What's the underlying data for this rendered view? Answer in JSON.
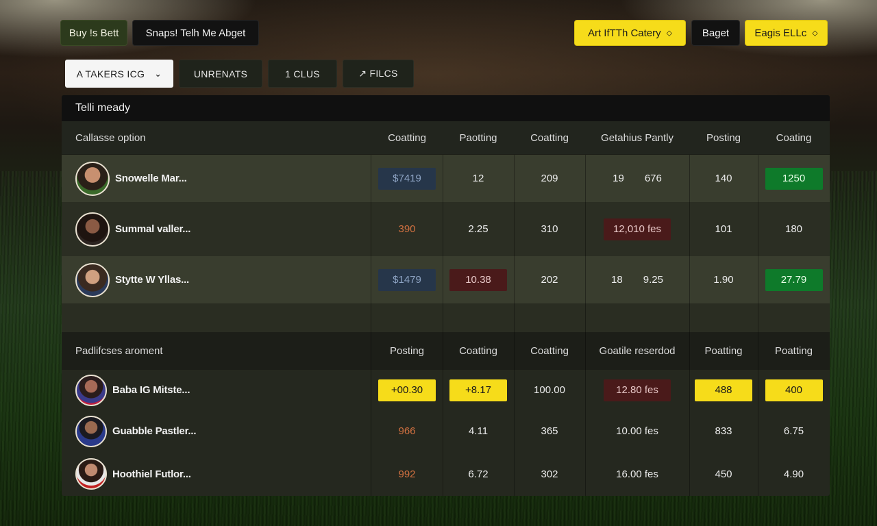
{
  "top_left_buttons": [
    "Buy !s Bett",
    "Snaps! Telh Me Abget"
  ],
  "top_right_buttons": [
    {
      "label": "Art IfTTh Catery",
      "chevron": "⬦"
    },
    {
      "label": "Baget"
    },
    {
      "label": "Eagis ELLc",
      "chevron": "⬦"
    }
  ],
  "filters": [
    {
      "label": "A TAKERS ICG",
      "chevron": "⌄"
    },
    {
      "label": "UNRENATS"
    },
    {
      "label": "1 CLUS"
    },
    {
      "label": "↗ FILCS"
    }
  ],
  "panel": {
    "title": "Telli meady"
  },
  "section1": {
    "header": [
      "Callasse option",
      "Coatting",
      "Paotting",
      "Coatting",
      "Getahius Pantly",
      "Posting",
      "Coating"
    ],
    "rows": [
      {
        "name": "Snowelle Mar...",
        "cells": [
          "$7419",
          "12",
          "209",
          "19",
          "676",
          "140",
          "1250"
        ]
      },
      {
        "name": "Summal valler...",
        "cells": [
          "390",
          "2.25",
          "310",
          "12,010 fes",
          "101",
          "180"
        ]
      },
      {
        "name": "Stytte W Yllas...",
        "cells": [
          "$1479",
          "10.38",
          "202",
          "18",
          "9.25",
          "1.90",
          "27.79"
        ]
      }
    ]
  },
  "section2": {
    "header": [
      "Padlifcses aroment",
      "Posting",
      "Coatting",
      "Coatting",
      "Goatile reserdod",
      "Poatting",
      "Poatting"
    ],
    "rows": [
      {
        "name": "Baba IG Mitste...",
        "cells": [
          "+00.30",
          "+8.17",
          "100.00",
          "12.80 fes",
          "488",
          "400"
        ]
      },
      {
        "name": "Guabble Pastler...",
        "cells": [
          "966",
          "4.11",
          "365",
          "10.00 fes",
          "833",
          "6.75"
        ]
      },
      {
        "name": "Hoothiel Futlor...",
        "cells": [
          "992",
          "6.72",
          "302",
          "16.00 fes",
          "450",
          "4.90"
        ]
      }
    ]
  },
  "colors": {
    "accent_yellow": "#f6dc1a",
    "positive_green": "#0e7a2a",
    "negative_red": "#4a1a1a",
    "neutral_blue": "#26364a",
    "orange_value": "#d07040"
  }
}
